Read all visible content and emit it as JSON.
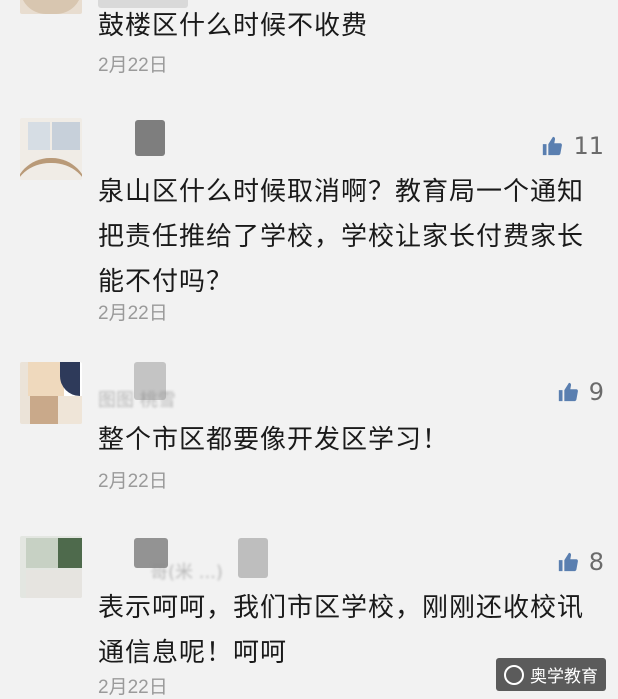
{
  "comments": [
    {
      "text": "鼓楼区什么时候不收费",
      "date": "2月22日"
    },
    {
      "text": "泉山区什么时候取消啊？教育局一个通知把责任推给了学校，学校让家长付费家长能不付吗？",
      "date": "2月22日",
      "likes": "11"
    },
    {
      "text": "整个市区都要像开发区学习！",
      "date": "2月22日",
      "likes": "9",
      "nickname": "图图 桃雪"
    },
    {
      "text": "表示呵呵，我们市区学校，刚刚还收校讯通信息呢！呵呵",
      "date": "2月22日",
      "likes": "8",
      "nickname": "哥(米 ...)"
    }
  ],
  "watermark": {
    "text": "奥学教育"
  },
  "colors": {
    "like_icon": "#5a7fb0",
    "text": "#1a1a1a",
    "date": "#9a9a9a",
    "background": "#f2f2f2"
  }
}
